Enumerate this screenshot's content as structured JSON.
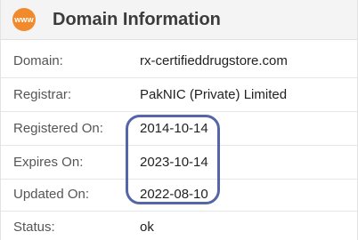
{
  "header": {
    "badge_text": "www",
    "title": "Domain Information",
    "badge_color": "#f08a2c"
  },
  "rows": [
    {
      "label": "Domain:",
      "value": "rx-certifieddrugstore.com"
    },
    {
      "label": "Registrar:",
      "value": "PakNIC (Private) Limited"
    },
    {
      "label": "Registered On:",
      "value": "2014-10-14"
    },
    {
      "label": "Expires On:",
      "value": "2023-10-14"
    },
    {
      "label": "Updated On:",
      "value": "2022-08-10"
    },
    {
      "label": "Status:",
      "value": "ok"
    }
  ],
  "highlight_color": "#5566a8"
}
